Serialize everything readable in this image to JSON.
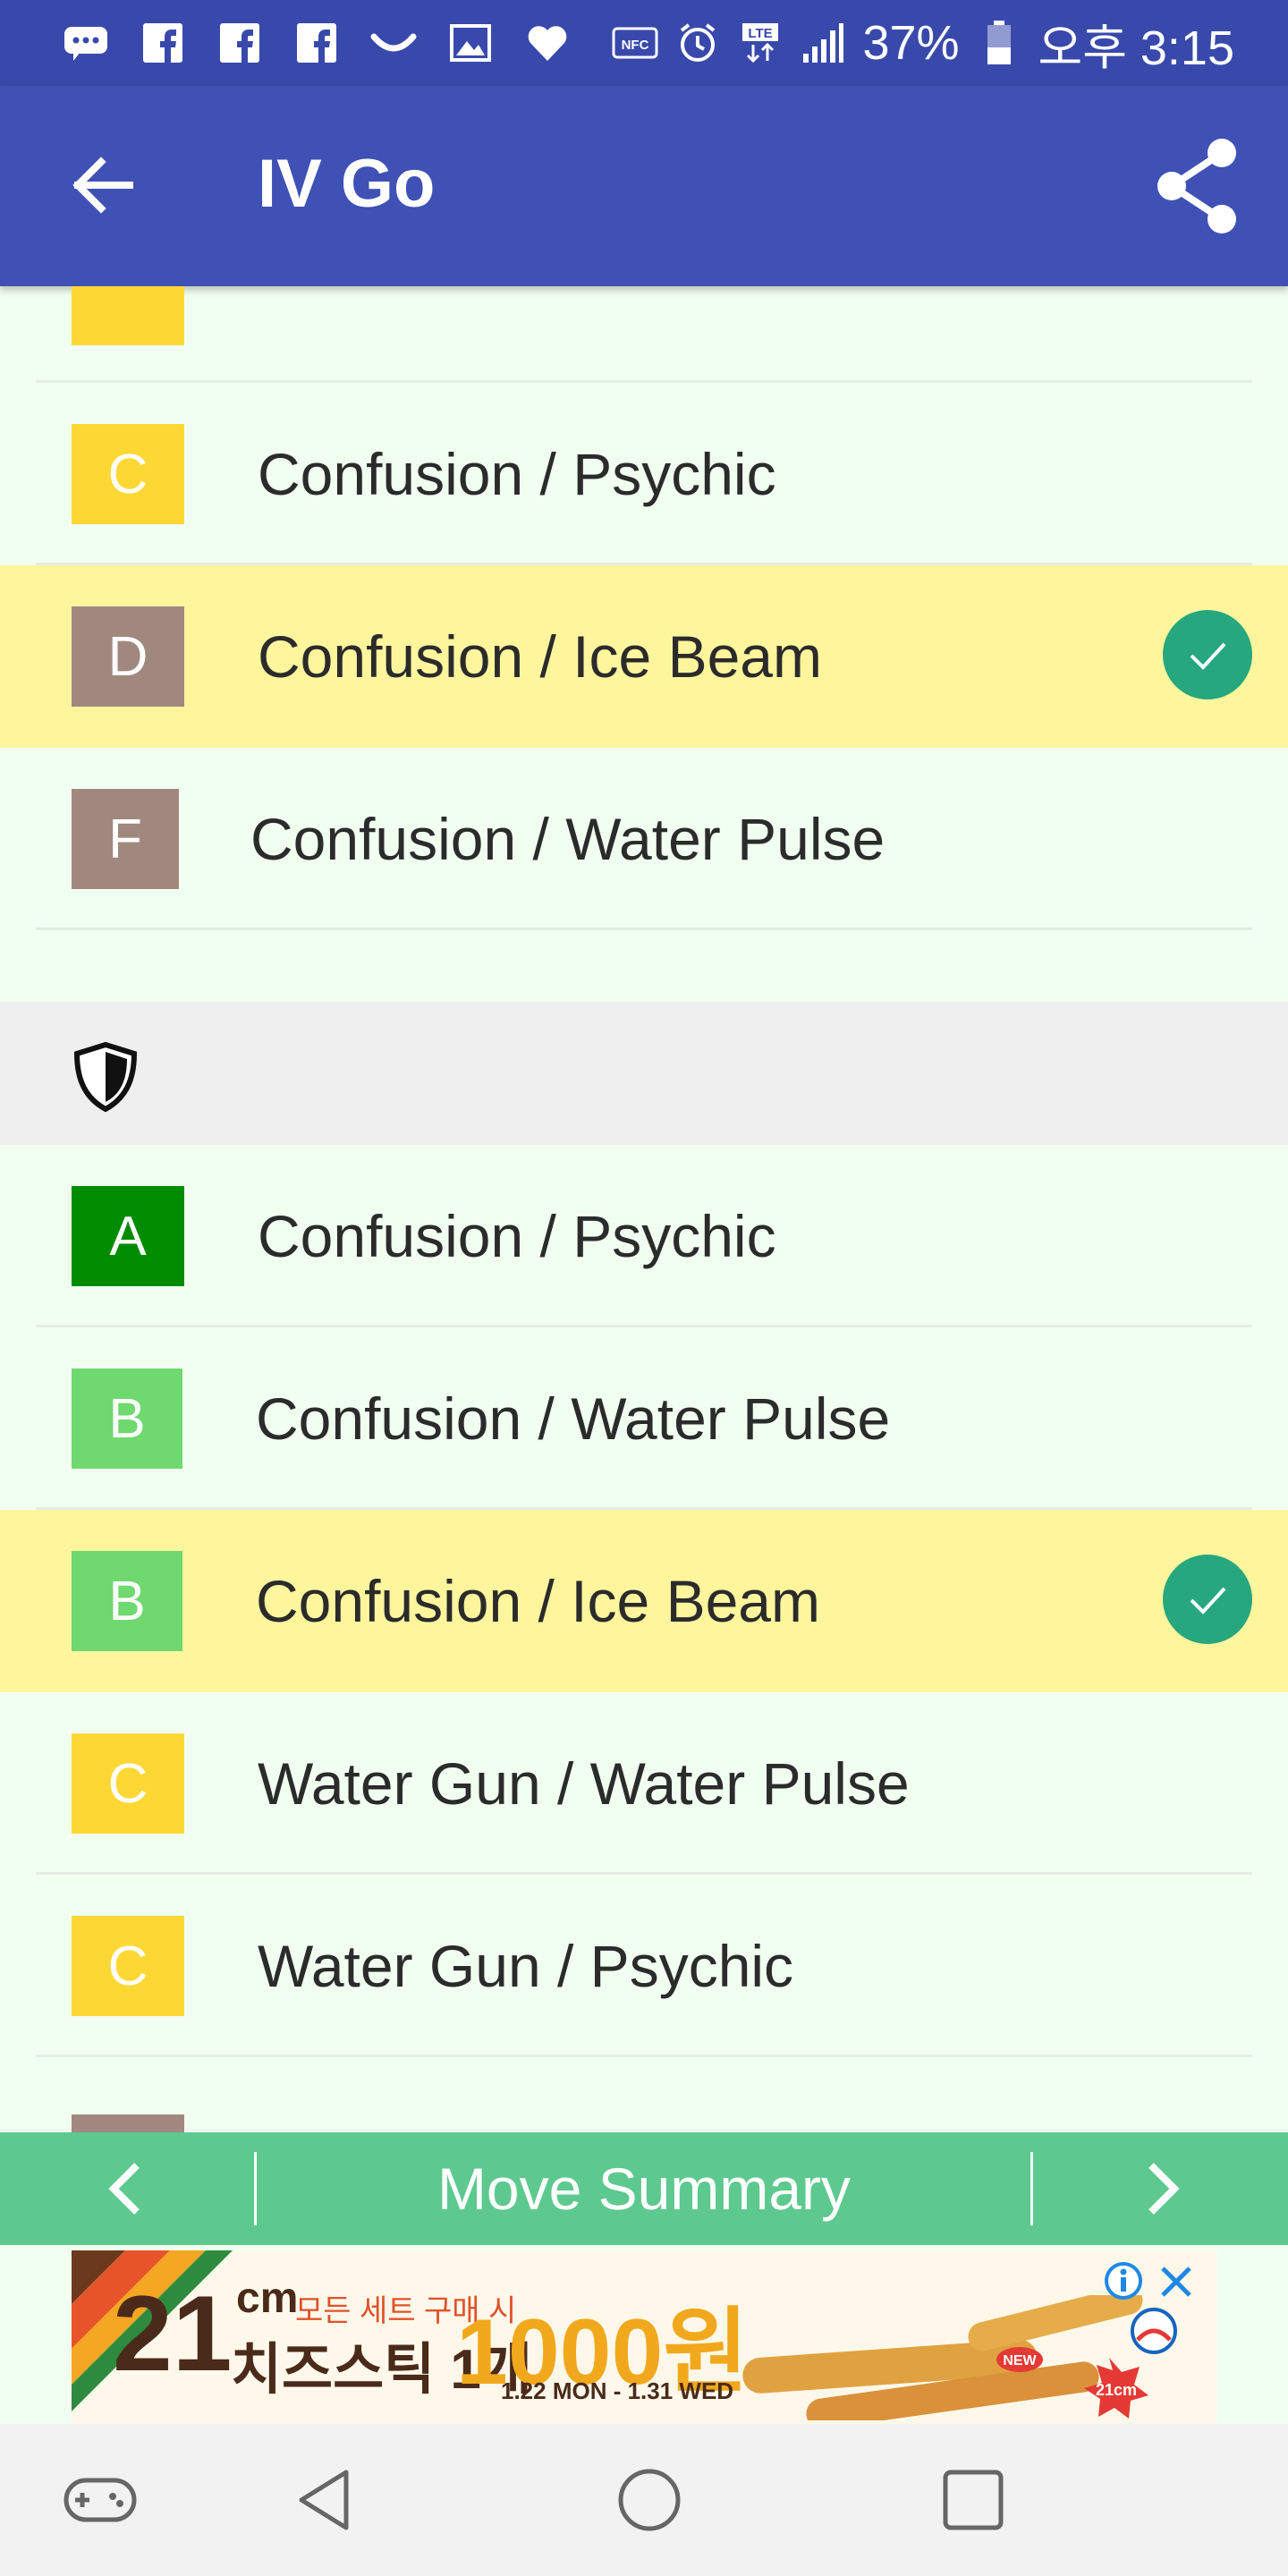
{
  "status_bar": {
    "battery_percent": "37%",
    "time": "오후 3:15",
    "icons_left": [
      "chat-icon",
      "facebook-icon",
      "facebook-icon",
      "facebook-icon",
      "smile-icon",
      "image-icon",
      "heart-icon"
    ],
    "icons_right": [
      "nfc-icon",
      "alarm-icon",
      "lte-icon",
      "signal-icon",
      "battery-icon"
    ]
  },
  "app_bar": {
    "title": "IV Go"
  },
  "section_top": {
    "rows": [
      {
        "grade": "C",
        "grade_color": "#fdd835",
        "move": "Confusion / Psychic",
        "highlighted": false
      },
      {
        "grade": "D",
        "grade_color": "#a1887f",
        "move": "Confusion / Ice Beam",
        "highlighted": true
      },
      {
        "grade": "F",
        "grade_color": "#a1887f",
        "move": "Confusion / Water Pulse",
        "highlighted": false
      }
    ]
  },
  "section_defense": {
    "icon": "shield-icon",
    "rows": [
      {
        "grade": "A",
        "grade_color": "#008c00",
        "move": "Confusion / Psychic",
        "highlighted": false
      },
      {
        "grade": "B",
        "grade_color": "#6fd86f",
        "move": "Confusion / Water Pulse",
        "highlighted": false
      },
      {
        "grade": "B",
        "grade_color": "#6fd86f",
        "move": "Confusion / Ice Beam",
        "highlighted": true
      },
      {
        "grade": "C",
        "grade_color": "#fdd835",
        "move": "Water Gun / Water Pulse",
        "highlighted": false
      },
      {
        "grade": "C",
        "grade_color": "#fdd835",
        "move": "Water Gun / Psychic",
        "highlighted": false
      }
    ]
  },
  "summary_bar": {
    "title": "Move Summary"
  },
  "ad": {
    "size": "21",
    "unit": "cm",
    "line1": "모든 세트 구매 시",
    "line2": "치즈스틱 1개",
    "price": "1000원",
    "dates": "1.22 MON - 1.31 WED",
    "badge_new": "NEW",
    "badge_size": "21cm"
  },
  "colors": {
    "accent": "#3f51b5",
    "status": "#3949ab",
    "highlight": "#fff59d",
    "check": "#26a77e",
    "summary": "#5ec98e"
  }
}
